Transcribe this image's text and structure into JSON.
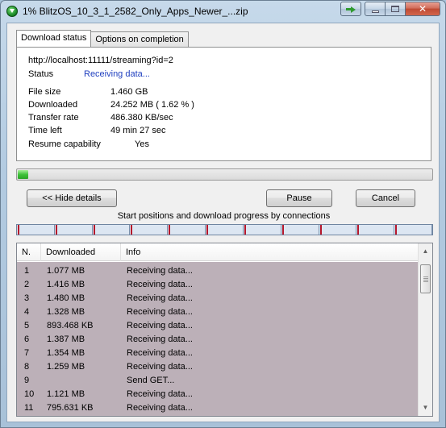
{
  "window": {
    "title": "1% BlitzOS_10_3_1_2582_Only_Apps_Newer_...zip",
    "close_glyph": "✕"
  },
  "tabs": [
    {
      "label": "Download status",
      "active": true
    },
    {
      "label": "Options on completion",
      "active": false
    }
  ],
  "status": {
    "url": "http://localhost:11111/streaming?id=2",
    "status_label": "Status",
    "status_value": "Receiving data...",
    "file_size_label": "File size",
    "file_size_value": "1.460  GB",
    "downloaded_label": "Downloaded",
    "downloaded_value": "24.252  MB  ( 1.62 % )",
    "transfer_rate_label": "Transfer rate",
    "transfer_rate_value": "486.380  KB/sec",
    "time_left_label": "Time left",
    "time_left_value": "49 min 27 sec",
    "resume_label": "Resume capability",
    "resume_value": "Yes"
  },
  "progress": {
    "fraction": 0.0162,
    "color": "#3fc23a"
  },
  "buttons": {
    "hide_details": "<< Hide details",
    "pause": "Pause",
    "cancel": "Cancel"
  },
  "connections": {
    "caption": "Start positions and download progress by connections",
    "segment_count": 11,
    "marker_color": "#b5162b"
  },
  "list": {
    "columns": [
      "N.",
      "Downloaded",
      "Info"
    ],
    "rows": [
      {
        "n": "1",
        "downloaded": "1.077  MB",
        "info": "Receiving data..."
      },
      {
        "n": "2",
        "downloaded": "1.416  MB",
        "info": "Receiving data..."
      },
      {
        "n": "3",
        "downloaded": "1.480  MB",
        "info": "Receiving data..."
      },
      {
        "n": "4",
        "downloaded": "1.328  MB",
        "info": "Receiving data..."
      },
      {
        "n": "5",
        "downloaded": "893.468  KB",
        "info": "Receiving data..."
      },
      {
        "n": "6",
        "downloaded": "1.387  MB",
        "info": "Receiving data..."
      },
      {
        "n": "7",
        "downloaded": "1.354  MB",
        "info": "Receiving data..."
      },
      {
        "n": "8",
        "downloaded": "1.259  MB",
        "info": "Receiving data..."
      },
      {
        "n": "9",
        "downloaded": "",
        "info": "Send GET..."
      },
      {
        "n": "10",
        "downloaded": "1.121  MB",
        "info": "Receiving data..."
      },
      {
        "n": "11",
        "downloaded": "795.631  KB",
        "info": "Receiving data..."
      }
    ],
    "row_background": "#bcb0b8"
  }
}
